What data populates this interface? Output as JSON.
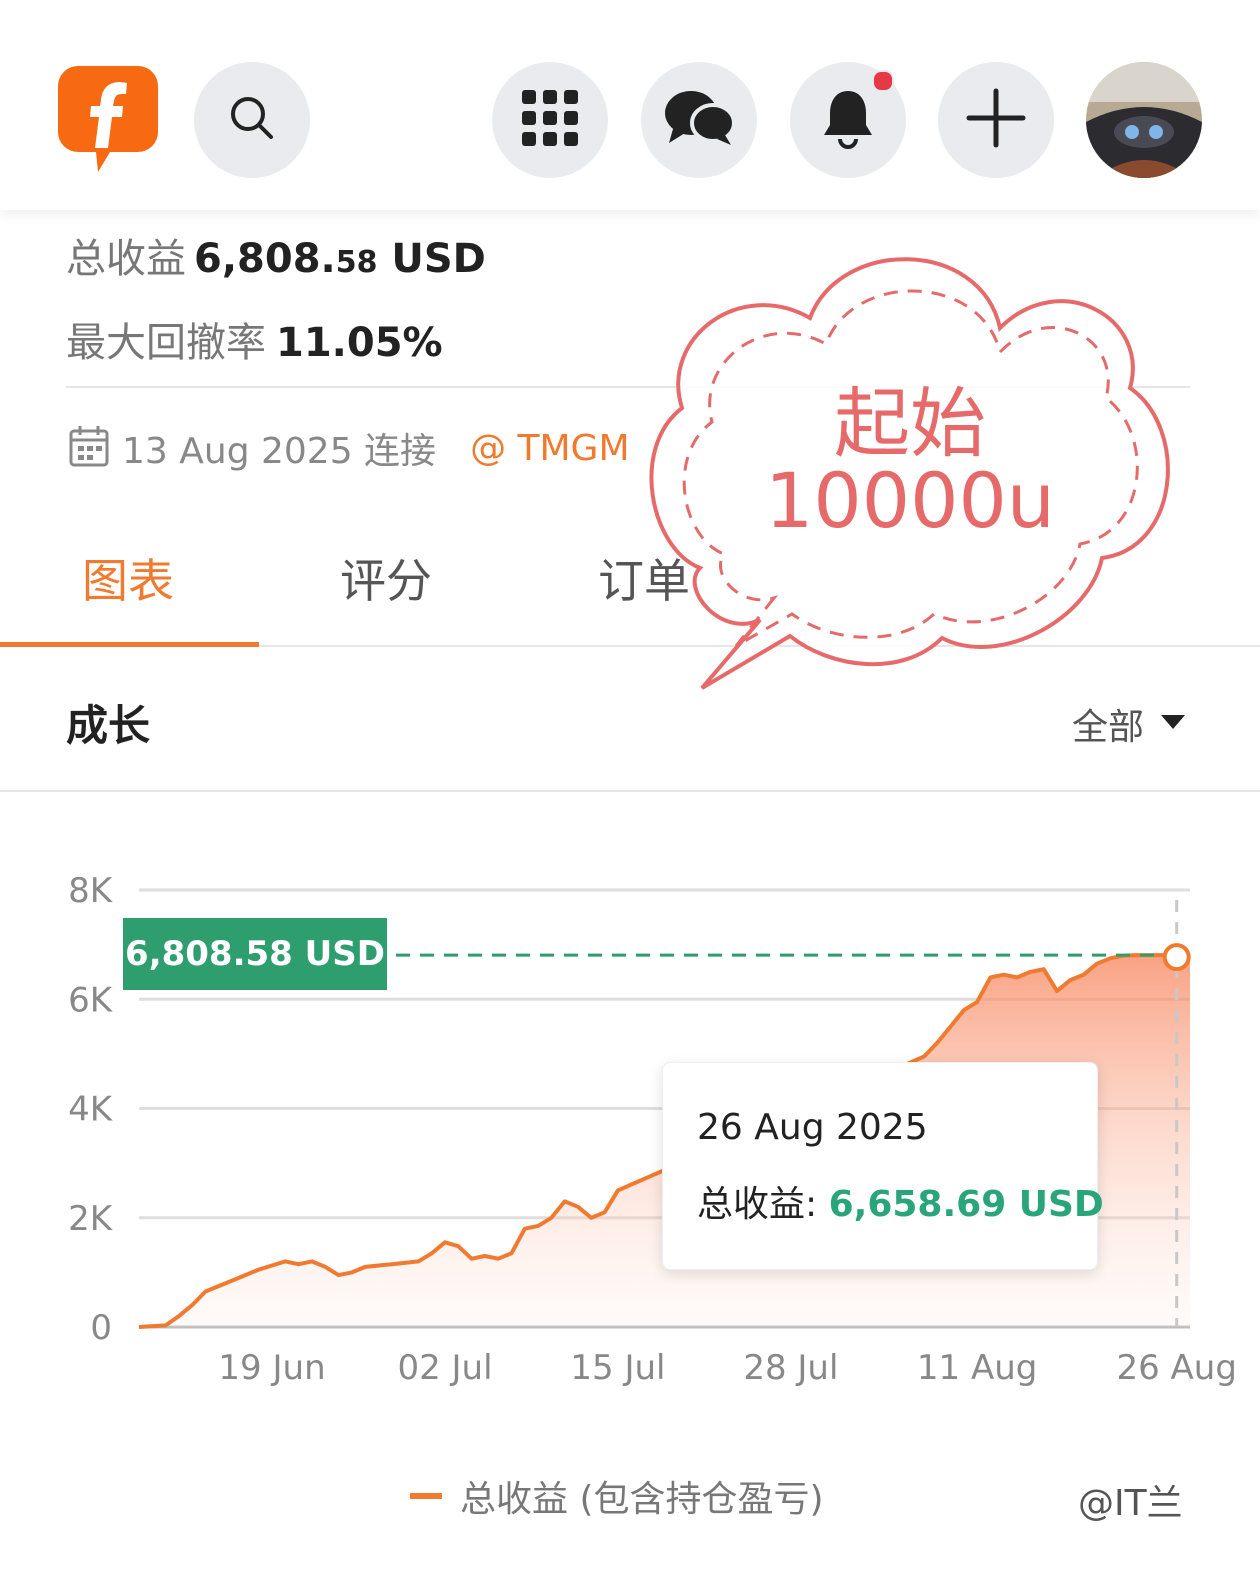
{
  "topbar": {
    "logo": "forex-app-logo",
    "icons": [
      "search-icon",
      "apps-grid-icon",
      "chat-icon",
      "bell-icon",
      "plus-icon"
    ],
    "has_notification": true
  },
  "summary": {
    "total_label": "总收益",
    "total_value_main": "6,808.",
    "total_value_cents": "58",
    "total_value_unit": " USD",
    "drawdown_label": "最大回撤率",
    "drawdown_value": "11.05%"
  },
  "meta": {
    "date_text": "13 Aug 2025 连接",
    "broker": "@ TMGM"
  },
  "tabs": [
    {
      "label": "图表",
      "active": true
    },
    {
      "label": "评分",
      "active": false
    },
    {
      "label": "订单",
      "active": false
    }
  ],
  "section": {
    "title": "成长",
    "filter": "全部"
  },
  "chart_data": {
    "type": "area",
    "y_ticks": [
      "8K",
      "6K",
      "4K",
      "2K",
      "0"
    ],
    "ylim": [
      0,
      8000
    ],
    "x_tick_labels": [
      "19 Jun",
      "02 Jul",
      "15 Jul",
      "28 Jul",
      "11 Aug",
      "26 Aug"
    ],
    "x_ticks": [
      "2025-06-19",
      "2025-07-02",
      "2025-07-15",
      "2025-07-28",
      "2025-08-11",
      "2025-08-26"
    ],
    "xlim": [
      "2025-06-09",
      "2025-08-27"
    ],
    "series": [
      {
        "name": "总收益 (包含持仓盈亏)",
        "color": "#f07a2f",
        "points": [
          [
            "2025-06-09",
            0
          ],
          [
            "2025-06-11",
            30
          ],
          [
            "2025-06-12",
            200
          ],
          [
            "2025-06-13",
            400
          ],
          [
            "2025-06-14",
            650
          ],
          [
            "2025-06-16",
            850
          ],
          [
            "2025-06-17",
            950
          ],
          [
            "2025-06-18",
            1050
          ],
          [
            "2025-06-20",
            1200
          ],
          [
            "2025-06-21",
            1150
          ],
          [
            "2025-06-22",
            1200
          ],
          [
            "2025-06-23",
            1100
          ],
          [
            "2025-06-24",
            950
          ],
          [
            "2025-06-25",
            1000
          ],
          [
            "2025-06-26",
            1100
          ],
          [
            "2025-06-28",
            1150
          ],
          [
            "2025-06-30",
            1200
          ],
          [
            "2025-07-01",
            1350
          ],
          [
            "2025-07-02",
            1550
          ],
          [
            "2025-07-03",
            1480
          ],
          [
            "2025-07-04",
            1250
          ],
          [
            "2025-07-05",
            1300
          ],
          [
            "2025-07-06",
            1250
          ],
          [
            "2025-07-07",
            1350
          ],
          [
            "2025-07-08",
            1800
          ],
          [
            "2025-07-09",
            1850
          ],
          [
            "2025-07-10",
            2000
          ],
          [
            "2025-07-11",
            2300
          ],
          [
            "2025-07-12",
            2200
          ],
          [
            "2025-07-13",
            2000
          ],
          [
            "2025-07-14",
            2100
          ],
          [
            "2025-07-15",
            2500
          ],
          [
            "2025-08-07",
            4950
          ],
          [
            "2025-08-08",
            5200
          ],
          [
            "2025-08-09",
            5500
          ],
          [
            "2025-08-10",
            5800
          ],
          [
            "2025-08-11",
            5950
          ],
          [
            "2025-08-12",
            6400
          ],
          [
            "2025-08-13",
            6450
          ],
          [
            "2025-08-14",
            6400
          ],
          [
            "2025-08-15",
            6500
          ],
          [
            "2025-08-16",
            6550
          ],
          [
            "2025-08-17",
            6150
          ],
          [
            "2025-08-18",
            6350
          ],
          [
            "2025-08-19",
            6450
          ],
          [
            "2025-08-20",
            6650
          ],
          [
            "2025-08-21",
            6750
          ],
          [
            "2025-08-22",
            6800
          ],
          [
            "2025-08-23",
            6808.58
          ]
        ]
      }
    ],
    "current_value_label": "6,808.58 USD",
    "current_value": 6808.58,
    "tooltip": {
      "date": "26 Aug 2025",
      "label": "总收益:",
      "value": "6,658.69 USD"
    },
    "legend": "总收益 (包含持仓盈亏)",
    "grid": true
  },
  "annotation": {
    "line1": "起始",
    "line2": "10000u",
    "color": "#e66a6a"
  },
  "watermark": "@IT兰"
}
